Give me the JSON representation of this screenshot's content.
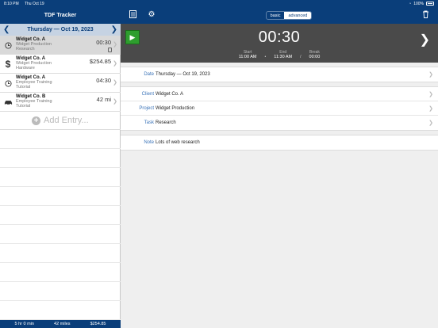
{
  "status_bar": {
    "time": "8:10 PM",
    "date": "Thu Oct 19",
    "battery": "100%"
  },
  "left": {
    "title": "TDF Tracker",
    "date": "Thursday — Oct 19, 2023",
    "entries": [
      {
        "icon": "clock-icon",
        "client": "Widget Co. A",
        "line2": "Widget Production",
        "line3": "Research",
        "value": "00:30",
        "selected": true
      },
      {
        "icon": "dollar-icon",
        "client": "Widget Co. A",
        "line2": "Widget Production",
        "line3": "Hardware",
        "value": "$254.85"
      },
      {
        "icon": "clock-icon",
        "client": "Widget Co. A",
        "line2": "Employee Training",
        "line3": "Tutorial",
        "value": "04:30"
      },
      {
        "icon": "car-icon",
        "client": "Widget Co. B",
        "line2": "Employee Training",
        "line3": "Tutorial",
        "value": "42 mi"
      }
    ],
    "add_label": "Add Entry...",
    "footer": {
      "hours": "5 hr 0 min",
      "miles": "42 miles",
      "amount": "$254.85"
    }
  },
  "right": {
    "segment": {
      "basic": "basic",
      "advanced": "advanced"
    },
    "timer": {
      "time": "00:30",
      "start_label": "Start",
      "start": "11:00 AM",
      "end_label": "End",
      "end": "11:30 AM",
      "break_label": "Break",
      "break": "00:00"
    },
    "date_label": "Date",
    "date_value": "Thursday — Oct 19, 2023",
    "client_label": "Client",
    "client_value": "Widget Co. A",
    "project_label": "Project",
    "project_value": "Widget Production",
    "task_label": "Task",
    "task_value": "Research",
    "note_label": "Note",
    "note_value": "Lots of web research"
  }
}
